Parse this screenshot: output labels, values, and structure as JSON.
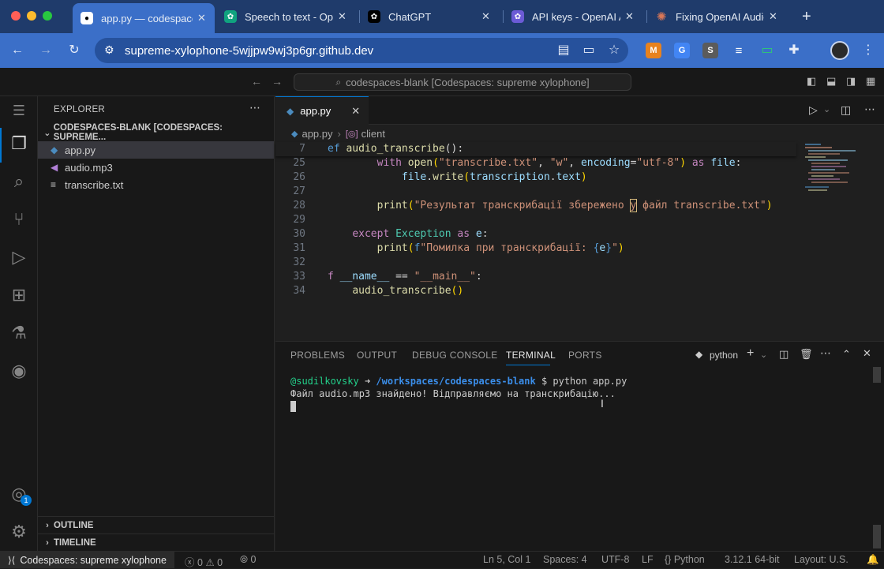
{
  "browser": {
    "tabs": [
      {
        "title": "app.py — codespaces-blank",
        "icon": "github-icon",
        "color": "#ffffff"
      },
      {
        "title": "Speech to text - OpenAI API",
        "icon": "openai-icon",
        "color": "#10a37f"
      },
      {
        "title": "ChatGPT",
        "icon": "openai-icon",
        "color": "#000000"
      },
      {
        "title": "API keys - OpenAI API",
        "icon": "openai-icon",
        "color": "#6b5bd6"
      },
      {
        "title": "Fixing OpenAI Audio",
        "icon": "claude-icon",
        "color": "#d97757"
      }
    ],
    "url": "supreme-xylophone-5wjjpw9wj3p6gr.github.dev",
    "new_tab": "+",
    "extensions": [
      "M",
      "G",
      "S",
      "≡"
    ]
  },
  "vscode": {
    "command_center": "codespaces-blank [Codespaces: supreme xylophone]",
    "explorer": {
      "title": "EXPLORER",
      "folder": "CODESPACES-BLANK [CODESPACES: SUPREME...",
      "files": [
        {
          "name": "app.py",
          "icon": "python-file-icon"
        },
        {
          "name": "audio.mp3",
          "icon": "audio-file-icon"
        },
        {
          "name": "transcribe.txt",
          "icon": "text-file-icon"
        }
      ],
      "outline": "OUTLINE",
      "timeline": "TIMELINE"
    },
    "accounts_badge": "1",
    "editor": {
      "tab": "app.py",
      "breadcrumb_file": "app.py",
      "breadcrumb_symbol": "client",
      "sticky": {
        "num": "7",
        "text": "ef audio_transcribe():"
      },
      "lines": [
        {
          "num": "25",
          "text": "with open(\"transcribe.txt\", \"w\", encoding=\"utf-8\") as file:"
        },
        {
          "num": "26",
          "text": "file.write(transcription.text)"
        },
        {
          "num": "27",
          "text": ""
        },
        {
          "num": "28",
          "text": "print(\"Результат транскрибації збережено у файл transcribe.txt\")"
        },
        {
          "num": "29",
          "text": ""
        },
        {
          "num": "30",
          "text": "except Exception as e:"
        },
        {
          "num": "31",
          "text": "print(f\"Помилка при транскрибації: {e}\")"
        },
        {
          "num": "32",
          "text": ""
        },
        {
          "num": "33",
          "text": "f __name__ == \"__main__\":"
        },
        {
          "num": "34",
          "text": "audio_transcribe()"
        }
      ]
    },
    "panel": {
      "tabs": [
        "PROBLEMS",
        "OUTPUT",
        "DEBUG CONSOLE",
        "TERMINAL",
        "PORTS"
      ],
      "active_tab": "TERMINAL",
      "shell": "python",
      "terminal": {
        "user": "@sudilkovsky",
        "arrow": "➜",
        "path": "/workspaces/codespaces-blank",
        "command": "$ python app.py",
        "output": "Файл audio.mp3 знайдено! Відправляємо на транскрибацію..."
      }
    },
    "status": {
      "remote": "Codespaces: supreme xylophone",
      "errors": "0",
      "warnings": "0",
      "ports": "0",
      "position": "Ln 5, Col 1",
      "spaces": "Spaces: 4",
      "encoding": "UTF-8",
      "eol": "LF",
      "language": "Python",
      "interpreter": "3.12.1 64-bit",
      "layout": "Layout: U.S."
    }
  }
}
